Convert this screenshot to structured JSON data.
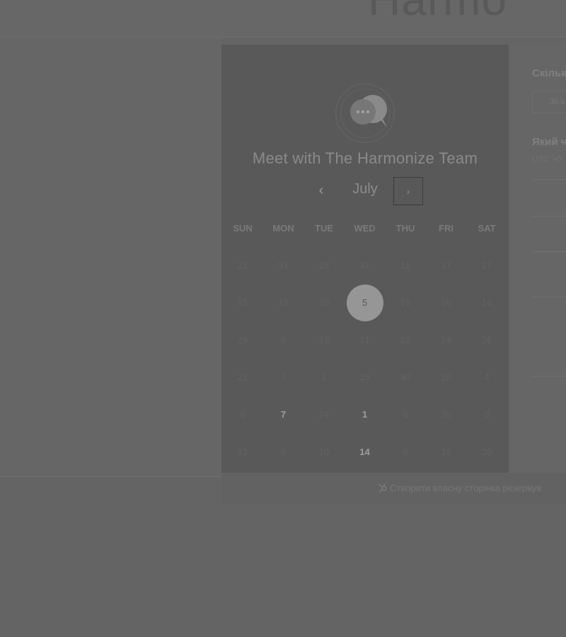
{
  "brand": {
    "name": "Harmo"
  },
  "calendar": {
    "title": "Meet with The Harmonize Team",
    "month": "July",
    "prev_icon": "chevron-left-icon",
    "next_icon": "chevron-right-icon",
    "weekdays": [
      "SUN",
      "MON",
      "TUE",
      "WED",
      "THU",
      "FRI",
      "SAT"
    ],
    "weeks": [
      [
        "21",
        "31",
        "28",
        "31",
        "11",
        "17",
        "27"
      ],
      [
        "15",
        "18",
        "10",
        "5",
        "19",
        "10",
        "14"
      ],
      [
        "29",
        "9",
        "16",
        "31",
        "22",
        "24",
        "26"
      ],
      [
        "21",
        "7",
        "2",
        "15",
        "30",
        "19",
        "4"
      ],
      [
        "6",
        "7",
        "24",
        "1",
        "8",
        "29",
        "6"
      ],
      [
        "13",
        "6",
        "10",
        "14",
        "6",
        "16",
        "20"
      ]
    ],
    "active_days": [
      "4-1",
      "4-3",
      "5-3"
    ],
    "selected_day": "1-3"
  },
  "right_panel": {
    "duration_label": "Скільк",
    "duration_value": "30 х",
    "time_label": "Який ч",
    "timezone": "UTC +0"
  },
  "footer": {
    "link_text": "Створити власну сторінка резервув",
    "icon": "hubspot-sprocket-icon"
  }
}
